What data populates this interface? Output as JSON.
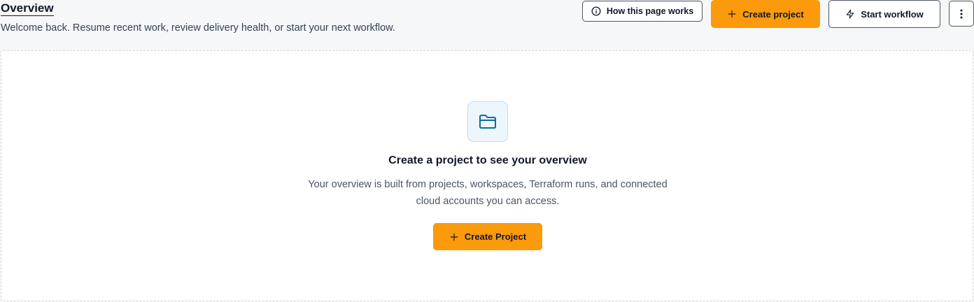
{
  "header": {
    "title": "Overview",
    "subtitle": "Welcome back. Resume recent work, review delivery health, or start your next workflow."
  },
  "actions": {
    "how_label": "How this page works",
    "create_label": "Create project",
    "workflow_label": "Start workflow",
    "more_icon": "more-vertical-icon"
  },
  "empty_state": {
    "icon": "folder-icon",
    "title": "Create a project to see your overview",
    "description_line1": "Your overview is built from projects, workspaces, Terraform runs, and connected",
    "description_line2": "cloud accounts you can access.",
    "button_label": "Create Project"
  },
  "colors": {
    "accent": "#fb9a0a",
    "icon_blue": "#0b6e99"
  }
}
